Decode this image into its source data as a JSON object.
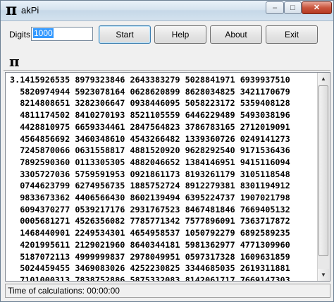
{
  "window": {
    "title": "akPi",
    "title_icon": "π",
    "minimize_label": "‒",
    "maximize_label": "□",
    "close_label": "✕"
  },
  "toolbar": {
    "digits_label": "Digits",
    "digits_value": "1000",
    "start_label": "Start",
    "help_label": "Help",
    "about_label": "About",
    "exit_label": "Exit"
  },
  "main": {
    "pi_symbol": "π",
    "digits_text": "3.1415926535 8979323846 2643383279 5028841971 6939937510\n  5820974944 5923078164 0628620899 8628034825 3421170679\n  8214808651 3282306647 0938446095 5058223172 5359408128\n  4811174502 8410270193 8521105559 6446229489 5493038196\n  4428810975 6659334461 2847564823 3786783165 2712019091\n  4564856692 3460348610 4543266482 1339360726 0249141273\n  7245870066 0631558817 4881520920 9628292540 9171536436\n  7892590360 0113305305 4882046652 1384146951 9415116094\n  3305727036 5759591953 0921861173 8193261179 3105118548\n  0744623799 6274956735 1885752724 8912279381 8301194912\n  9833673362 4406566430 8602139494 6395224737 1907021798\n  6094370277 0539217176 2931767523 8467481846 7669405132\n  0005681271 4526356082 7785771342 7577896091 7363717872\n  1468440901 2249534301 4654958537 1050792279 6892589235\n  4201995611 2129021960 8640344181 5981362977 4771309960\n  5187072113 4999999837 2978049951 0597317328 1609631859\n  5024459455 3469083026 4252230825 3344685035 2619311881\n  7101000313 7838752886 5875332083 8142061717 7669147303"
  },
  "status": {
    "text": "Time of calculations: 00:00:00"
  }
}
